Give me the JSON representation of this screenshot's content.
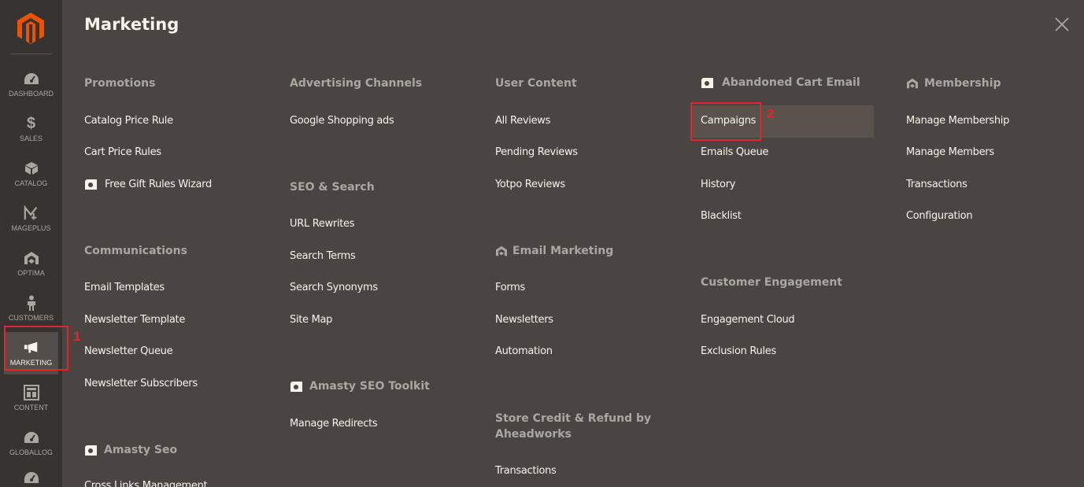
{
  "sidebar": {
    "items": [
      {
        "label": "DASHBOARD",
        "icon": "dashboard-icon"
      },
      {
        "label": "SALES",
        "icon": "dollar-icon"
      },
      {
        "label": "CATALOG",
        "icon": "box-icon"
      },
      {
        "label": "MAGEPLUS",
        "icon": "mageplus-icon"
      },
      {
        "label": "OPTIMA",
        "icon": "optima-icon"
      },
      {
        "label": "CUSTOMERS",
        "icon": "person-icon"
      },
      {
        "label": "MARKETING",
        "icon": "megaphone-icon",
        "active": true
      },
      {
        "label": "CONTENT",
        "icon": "layout-icon"
      },
      {
        "label": "GLOBALLOG",
        "icon": "dashboard-icon"
      },
      {
        "label": "",
        "icon": "dashboard-icon"
      }
    ],
    "dollar_glyph": "$"
  },
  "panel": {
    "title": "Marketing",
    "columns": [
      {
        "groups": [
          {
            "title": "Promotions",
            "links": [
              "Catalog Price Rule",
              "Cart Price Rules",
              "Free Gift Rules Wizard"
            ]
          },
          {
            "title": "Communications",
            "links": [
              "Email Templates",
              "Newsletter Template",
              "Newsletter Queue",
              "Newsletter Subscribers"
            ]
          },
          {
            "title": "Amasty Seo",
            "links": [
              "Cross Links Management"
            ]
          }
        ]
      },
      {
        "groups": [
          {
            "title": "Advertising Channels",
            "links": [
              "Google Shopping ads"
            ]
          },
          {
            "title": "SEO & Search",
            "links": [
              "URL Rewrites",
              "Search Terms",
              "Search Synonyms",
              "Site Map"
            ]
          },
          {
            "title": "Amasty SEO Toolkit",
            "links": [
              "Manage Redirects"
            ]
          }
        ]
      },
      {
        "groups": [
          {
            "title": "User Content",
            "links": [
              "All Reviews",
              "Pending Reviews",
              "Yotpo Reviews"
            ]
          },
          {
            "title": "Email Marketing",
            "links": [
              "Forms",
              "Newsletters",
              "Automation"
            ]
          },
          {
            "title": "Store Credit & Refund by Aheadworks",
            "links": [
              "Transactions"
            ]
          }
        ]
      },
      {
        "groups": [
          {
            "title": "Abandoned Cart Email",
            "links": [
              "Campaigns",
              "Emails Queue",
              "History",
              "Blacklist"
            ]
          },
          {
            "title": "Customer Engagement",
            "links": [
              "Engagement Cloud",
              "Exclusion Rules"
            ]
          }
        ]
      },
      {
        "groups": [
          {
            "title": "Membership",
            "links": [
              "Manage Membership",
              "Manage Members",
              "Transactions",
              "Configuration"
            ]
          }
        ]
      }
    ]
  },
  "annotations": {
    "step1": "1",
    "step2": "2"
  },
  "colors": {
    "sidebar_bg": "#373330",
    "panel_bg": "#4a4542",
    "accent": "#eb5202",
    "highlight": "#e22626"
  }
}
